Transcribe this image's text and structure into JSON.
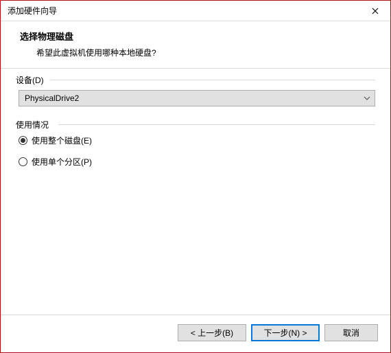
{
  "window": {
    "title": "添加硬件向导"
  },
  "header": {
    "title": "选择物理磁盘",
    "subtitle": "希望此虚拟机使用哪种本地硬盘?"
  },
  "device": {
    "group_label": "设备(D)",
    "selected": "PhysicalDrive2"
  },
  "usage": {
    "group_label": "使用情况",
    "options": [
      {
        "label": "使用整个磁盘(E)",
        "checked": true
      },
      {
        "label": "使用单个分区(P)",
        "checked": false
      }
    ]
  },
  "buttons": {
    "back": "< 上一步(B)",
    "next": "下一步(N) >",
    "cancel": "取消"
  }
}
